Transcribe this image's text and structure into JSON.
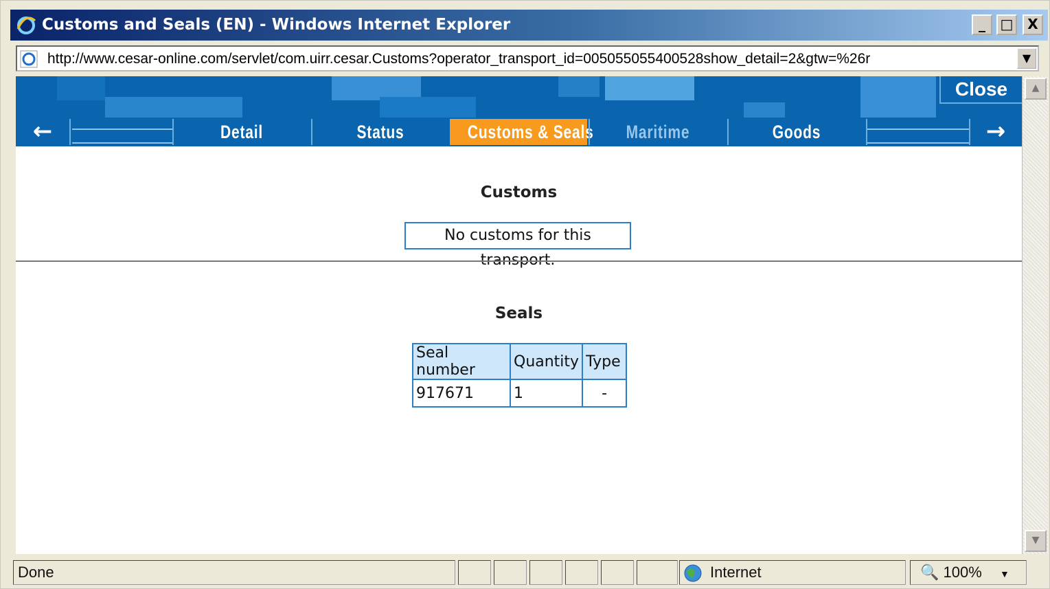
{
  "window": {
    "title": "Customs and Seals (EN) - Windows Internet Explorer",
    "minimize": "_",
    "maximize": "□",
    "close": "X"
  },
  "address": {
    "url": "http://www.cesar-online.com/servlet/com.uirr.cesar.Customs?operator_transport_id=005055055400528show_detail=2&gtw=%26r"
  },
  "nav": {
    "close_label": "Close",
    "tabs": [
      {
        "label": "Detail",
        "active": false
      },
      {
        "label": "Status",
        "active": false
      },
      {
        "label": "Customs & Seals",
        "active": true
      },
      {
        "label": "Maritime",
        "active": false,
        "disabled": true
      },
      {
        "label": "Goods",
        "active": false
      }
    ],
    "prev_icon": "arrow-left-icon",
    "next_icon": "arrow-right-icon"
  },
  "customs": {
    "title": "Customs",
    "message": "No customs for this transport."
  },
  "seals": {
    "title": "Seals",
    "columns": [
      "Seal number",
      "Quantity",
      "Type"
    ],
    "rows": [
      [
        "917671",
        "1",
        "-"
      ]
    ]
  },
  "status": {
    "text": "Done",
    "zone": "Internet",
    "zoom": "100%"
  },
  "colors": {
    "banner": "#0a64ae",
    "active_tab": "#f79a1e",
    "table_border": "#2b7fc7"
  }
}
